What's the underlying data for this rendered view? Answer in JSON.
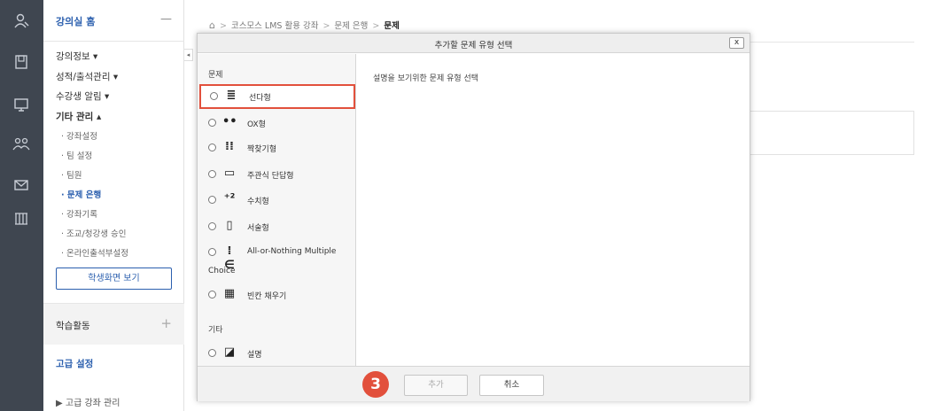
{
  "rail": {
    "icons": [
      "person-icon",
      "book-icon",
      "board-icon",
      "group-icon",
      "mail-icon",
      "library-icon"
    ]
  },
  "sidebar": {
    "home_label": "강의실 홈",
    "home_toggle": "—",
    "items": [
      {
        "label": "강의정보 ▾"
      },
      {
        "label": "성적/출석관리 ▾"
      },
      {
        "label": "수강생 알림 ▾"
      },
      {
        "label": "기타 관리 ▴"
      }
    ],
    "subitems": [
      {
        "label": "· 강좌설정"
      },
      {
        "label": "· 팀 설정"
      },
      {
        "label": "· 팀원"
      },
      {
        "label": "· 문제 은행"
      },
      {
        "label": "· 강좌기록"
      },
      {
        "label": "· 조교/청강생 승인"
      },
      {
        "label": "· 온라인출석부설정"
      }
    ],
    "student_view_button": "학생화면 보기",
    "learning_activity": "학습활동",
    "learning_activity_plus": "+",
    "advanced_settings": "고급 설정",
    "advanced_course_mgmt": "▶ 고급 강좌 관리"
  },
  "breadcrumb": {
    "home": "⌂",
    "items": [
      "코스모스 LMS 활용 강좌",
      "문제 은행"
    ],
    "current": "문제",
    "sep": ">"
  },
  "modal": {
    "title": "추가할 문제 유형 선택",
    "close": "x",
    "category_questions": "문제",
    "category_other": "기타",
    "description": "설명을 보기위한 문제 유형 선택",
    "question_types": [
      {
        "label": "선다형",
        "icon": "≣"
      },
      {
        "label": "OX형",
        "icon": "••"
      },
      {
        "label": "짝찾기형",
        "icon": "⁞⁞"
      },
      {
        "label": "주관식 단답형",
        "icon": "▭"
      },
      {
        "label": "수치형",
        "icon": "⁺²"
      },
      {
        "label": "서술형",
        "icon": "▯"
      },
      {
        "label": "All-or-Nothing Multiple",
        "icon": "⁞∈"
      },
      {
        "label": "빈칸 채우기",
        "icon": "▦"
      }
    ],
    "choice_continuation": "Choice",
    "other_types": [
      {
        "label": "설명",
        "icon": "◪"
      }
    ],
    "add_button": "추가",
    "cancel_button": "취소",
    "step_number": "3"
  }
}
